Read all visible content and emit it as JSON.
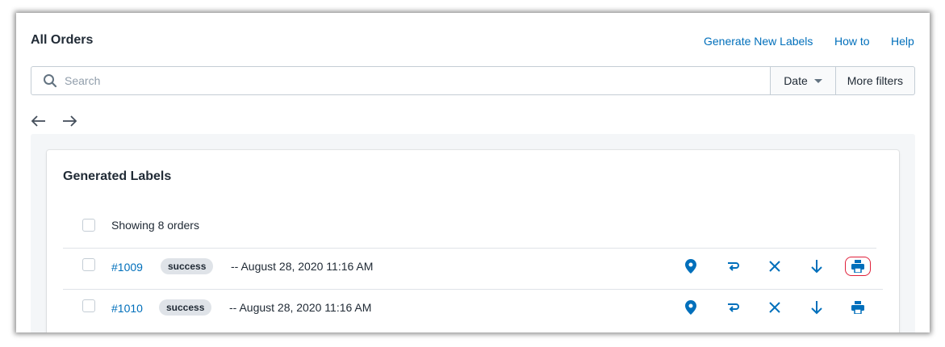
{
  "header": {
    "title": "All Orders",
    "links": {
      "generate": "Generate New Labels",
      "howto": "How to",
      "help": "Help"
    }
  },
  "filters": {
    "search_placeholder": "Search",
    "search_value": "",
    "date_label": "Date",
    "more_filters_label": "More filters"
  },
  "nav": {
    "back_icon": "arrow-left-icon",
    "forward_icon": "arrow-right-icon"
  },
  "card": {
    "title": "Generated Labels",
    "showing": "Showing 8 orders"
  },
  "orders": [
    {
      "number": "#1009",
      "status": "success",
      "date": "-- August 28, 2020 11:16 AM",
      "print_highlighted": true
    },
    {
      "number": "#1010",
      "status": "success",
      "date": "-- August 28, 2020 11:16 AM",
      "print_highlighted": false
    }
  ],
  "row_actions": [
    "location-pin-icon",
    "return-icon",
    "cancel-x-icon",
    "download-arrow-icon",
    "print-icon"
  ],
  "colors": {
    "accent": "#006fbb",
    "highlight": "#e0203a",
    "badge_bg": "#dfe3e8"
  }
}
